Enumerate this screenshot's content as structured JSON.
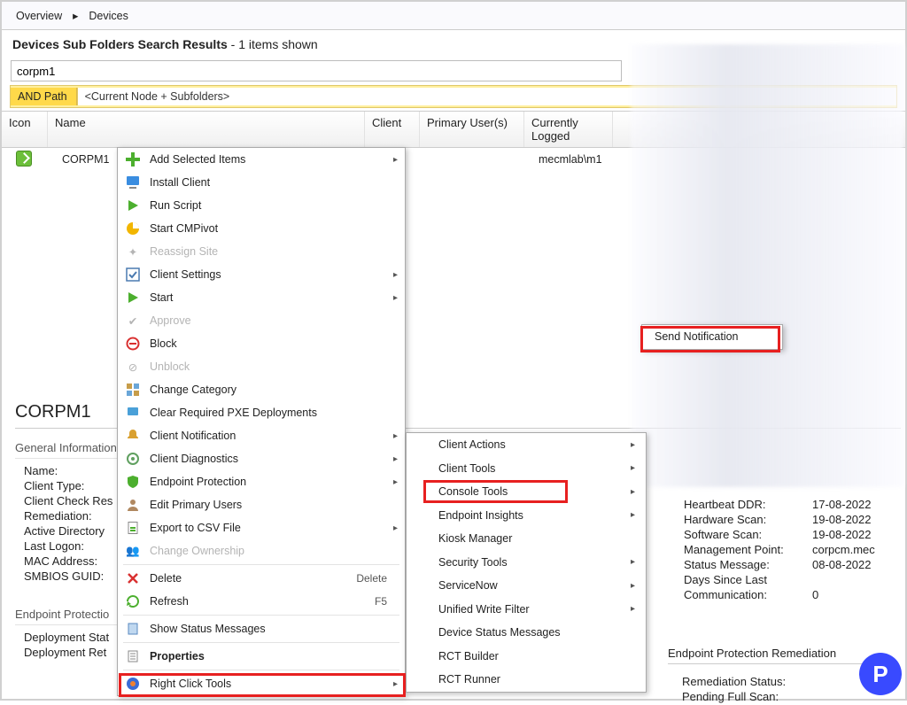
{
  "breadcrumb": {
    "overview": "Overview",
    "devices": "Devices"
  },
  "results": {
    "title": "Devices Sub Folders Search Results",
    "count_text": "1 items shown"
  },
  "search": {
    "value": "corpm1"
  },
  "filter": {
    "combo": "AND Path",
    "path": "<Current Node + Subfolders>"
  },
  "columns": {
    "icon": "Icon",
    "name": "Name",
    "client": "Client",
    "primary": "Primary User(s)",
    "logged": "Currently Logged"
  },
  "row0": {
    "name": "CORPM1",
    "client": "",
    "primary": "",
    "logged": "mecmlab\\m1"
  },
  "menu": {
    "add": "Add Selected Items",
    "install": "Install Client",
    "run": "Run Script",
    "cmpivot": "Start CMPivot",
    "reassign": "Reassign Site",
    "clientset": "Client Settings",
    "start": "Start",
    "approve": "Approve",
    "block": "Block",
    "unblock": "Unblock",
    "changecat": "Change Category",
    "clearpxe": "Clear Required PXE Deployments",
    "clientnotif": "Client Notification",
    "clientdiag": "Client Diagnostics",
    "endpoint": "Endpoint Protection",
    "editprim": "Edit Primary Users",
    "exportcsv": "Export to CSV File",
    "changeown": "Change Ownership",
    "delete": "Delete",
    "delete_k": "Delete",
    "refresh": "Refresh",
    "refresh_k": "F5",
    "statmsg": "Show Status Messages",
    "props": "Properties",
    "rct": "Right Click Tools"
  },
  "sub": {
    "client_actions": "Client Actions",
    "client_tools": "Client Tools",
    "console_tools": "Console Tools",
    "endpoint_insights": "Endpoint Insights",
    "kiosk": "Kiosk Manager",
    "security": "Security Tools",
    "servicenow": "ServiceNow",
    "uwf": "Unified Write Filter",
    "dev_status": "Device Status Messages",
    "rct_builder": "RCT Builder",
    "rct_runner": "RCT Runner"
  },
  "sub2": {
    "send_notification": "Send Notification"
  },
  "details": {
    "title": "CORPM1",
    "geninfo": "General Information",
    "name": "Name:",
    "clienttype": "Client Type:",
    "clientcheck": "Client Check Res",
    "remediation": "Remediation:",
    "ad": "Active Directory",
    "lastlogon": "Last Logon:",
    "mac": "MAC Address:",
    "smbios": "SMBIOS GUID:",
    "epstatus": "Endpoint Protectio",
    "depstat": "Deployment Stat",
    "depret": "Deployment Ret",
    "heartbeat": "Heartbeat DDR:",
    "heartbeat_v": "17-08-2022",
    "hwscan": "Hardware Scan:",
    "hwscan_v": "19-08-2022",
    "swscan": "Software Scan:",
    "swscan_v": "19-08-2022",
    "mgmt": "Management Point:",
    "mgmt_v": "corpcm.mec",
    "statmsg": "Status Message:",
    "statmsg_v": "08-08-2022",
    "dayslast": "Days Since Last",
    "comm": "Communication:",
    "comm_v": "0",
    "ep_remed_title": "Endpoint Protection Remediation",
    "remed_status": "Remediation Status:",
    "pending": "Pending Full Scan:"
  }
}
